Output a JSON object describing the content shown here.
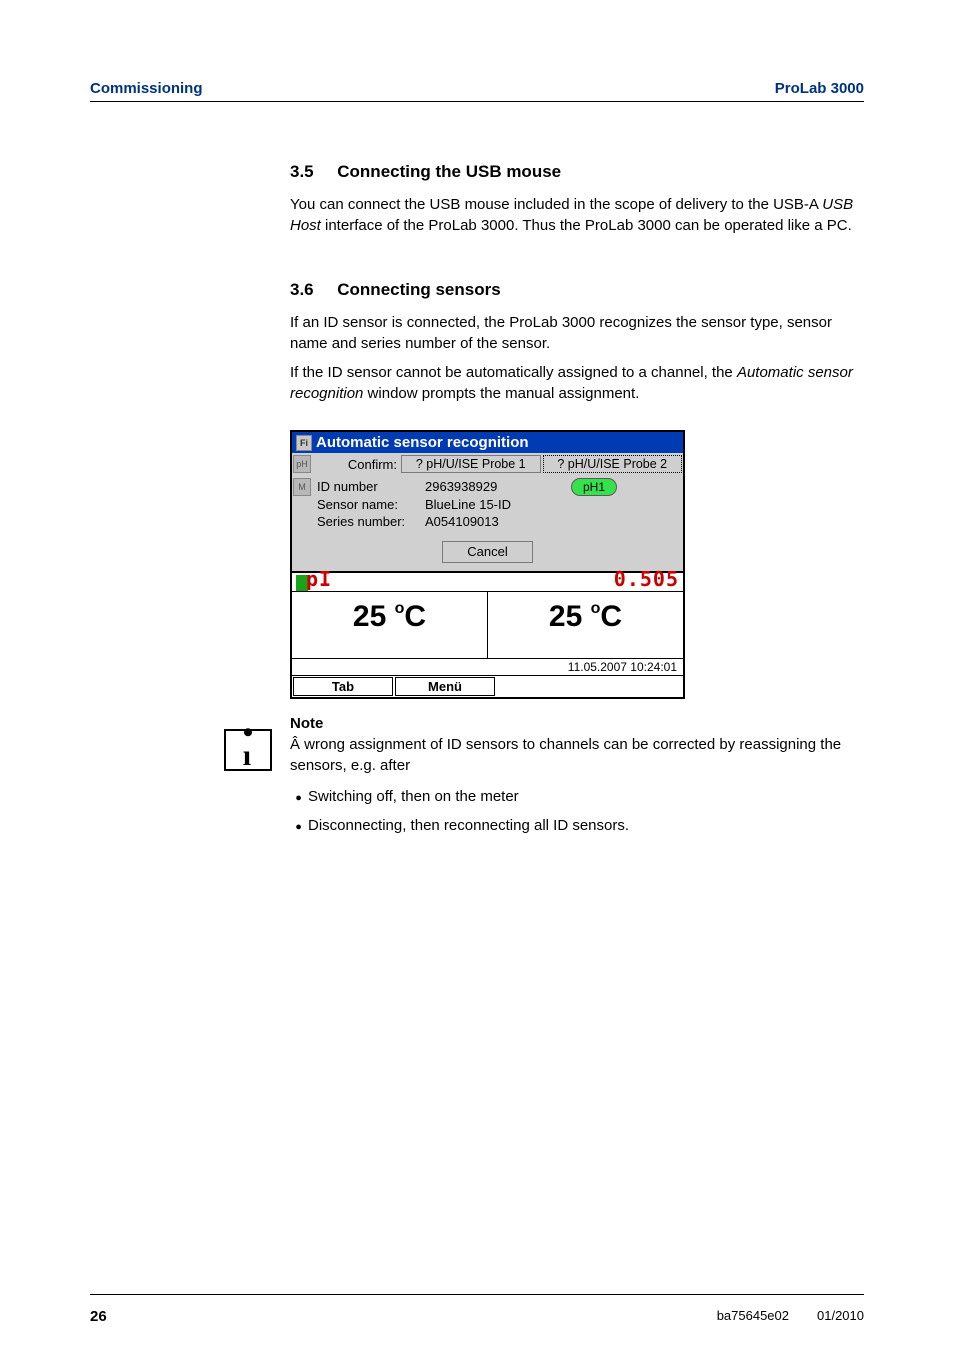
{
  "header": {
    "left": "Commissioning",
    "right": "ProLab 3000"
  },
  "section35": {
    "num": "3.5",
    "title": "Connecting the USB mouse",
    "p1a": "You can connect the USB mouse included in the scope of delivery to the USB-A ",
    "p1_italic": "USB Host",
    "p1b": " interface of the ProLab 3000. Thus the ProLab 3000 can be operated like a PC."
  },
  "section36": {
    "num": "3.6",
    "title": "Connecting sensors",
    "p1": "If an ID sensor is connected, the ProLab 3000 recognizes the sensor type, sensor name and series number of the sensor.",
    "p2a": "If the ID sensor cannot be automatically assigned to a channel, the ",
    "p2_italic": "Automatic sensor recognition",
    "p2b": " window prompts the manual assignment."
  },
  "dialog": {
    "title_icon": "Fi",
    "title": "Automatic sensor recognition",
    "edge_icon_top": "pH",
    "edge_icon_mid": "M",
    "confirm_label": "Confirm:",
    "btn1": "? pH/U/ISE Probe 1",
    "btn2": "? pH/U/ISE Probe 2",
    "lamp": "pH1",
    "info_labels": {
      "id": "ID number",
      "name": "Sensor name:",
      "series": "Series number:"
    },
    "info_values": {
      "id": "2963938929",
      "name": "BlueLine 15-ID",
      "series": "A054109013"
    },
    "cancel": "Cancel",
    "pl_label": "pI",
    "frag_right": "0.505",
    "temp_left": "25 ",
    "temp_right": "25 ",
    "temp_unit_pre": "o",
    "temp_unit_suf": "C",
    "timestamp": "11.05.2007 10:24:01",
    "tab": "Tab",
    "menu": "Menü"
  },
  "note": {
    "head": "Note",
    "body": "Â wrong assignment of ID sensors to channels can be corrected by reassigning the sensors, e.g. after",
    "b1": "Switching off, then on the meter",
    "b2": "Disconnecting, then reconnecting all ID sensors."
  },
  "footer": {
    "page": "26",
    "doc": "ba75645e02",
    "date": "01/2010"
  }
}
